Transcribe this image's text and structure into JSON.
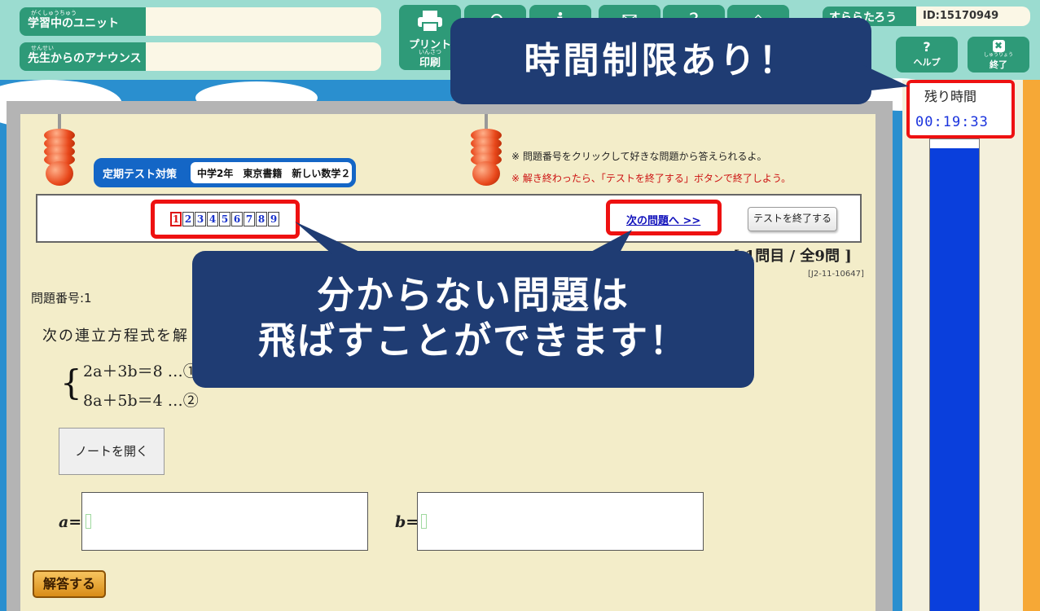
{
  "header": {
    "learning_unit_ruby": "がくしゅうちゅう",
    "learning_unit_label": "学習中のユニット",
    "learning_unit_value": "",
    "announce_ruby": "せんせい",
    "announce_label": "先生からのアナウンス",
    "announce_value": "",
    "print_label": "プリント",
    "print_ruby": "いんさつ",
    "print_label2": "印刷",
    "user_name": "すららたろう",
    "user_id": "ID:15170949",
    "help_icon": "?",
    "help_label": "ヘルプ",
    "end_ruby": "しゅうりょう",
    "end_label": "終了",
    "end_icon": "✖"
  },
  "timer": {
    "label": "残り時間",
    "value": "00:19:33",
    "remaining_fraction": 0.98
  },
  "badge": {
    "tag": "定期テスト対策",
    "course": "中学2年　東京書籍　新しい数学２"
  },
  "notes": {
    "line1": "※ 問題番号をクリックして好きな問題から答えられるよ。",
    "line2": "※ 解き終わったら、「テストを終了する」ボタンで終了しよう。"
  },
  "nav": {
    "question_numbers": [
      "1",
      "2",
      "3",
      "4",
      "5",
      "6",
      "7",
      "8",
      "9"
    ],
    "current_question": "1",
    "next_link": "次の問題へ >>",
    "end_test_button": "テストを終了する"
  },
  "question": {
    "progress": "[ 1問目 / 全9問 ]",
    "code": "[J2-11-10647]",
    "number_label": "問題番号:1",
    "text": "次の連立方程式を解",
    "eq1": "2a＋3b＝8 …①",
    "eq2": "8a＋5b＝4 …②",
    "note_button": "ノートを開く",
    "answer_a_label": "a=",
    "answer_b_label": "b=",
    "answer_a_value": "",
    "answer_b_value": "",
    "submit_button": "解答する"
  },
  "callouts": {
    "time_limit": "時間制限あり！",
    "skip_line1": "分からない問題は",
    "skip_line2": "飛ばすことができます！"
  },
  "colors": {
    "header_bg": "#9bdcd0",
    "header_green": "#2e9a78",
    "sheet_bg": "#f3edc9",
    "callout_bg": "#1f3c73",
    "highlight_red": "#ee1111",
    "timer_blue": "#0a3fdc",
    "sky": "#2a8fcf"
  },
  "icons": {
    "print": "printer-icon",
    "back": "back-arrow-icon",
    "info": "info-icon",
    "mail": "mail-icon",
    "help": "question-icon",
    "end": "close-icon"
  }
}
